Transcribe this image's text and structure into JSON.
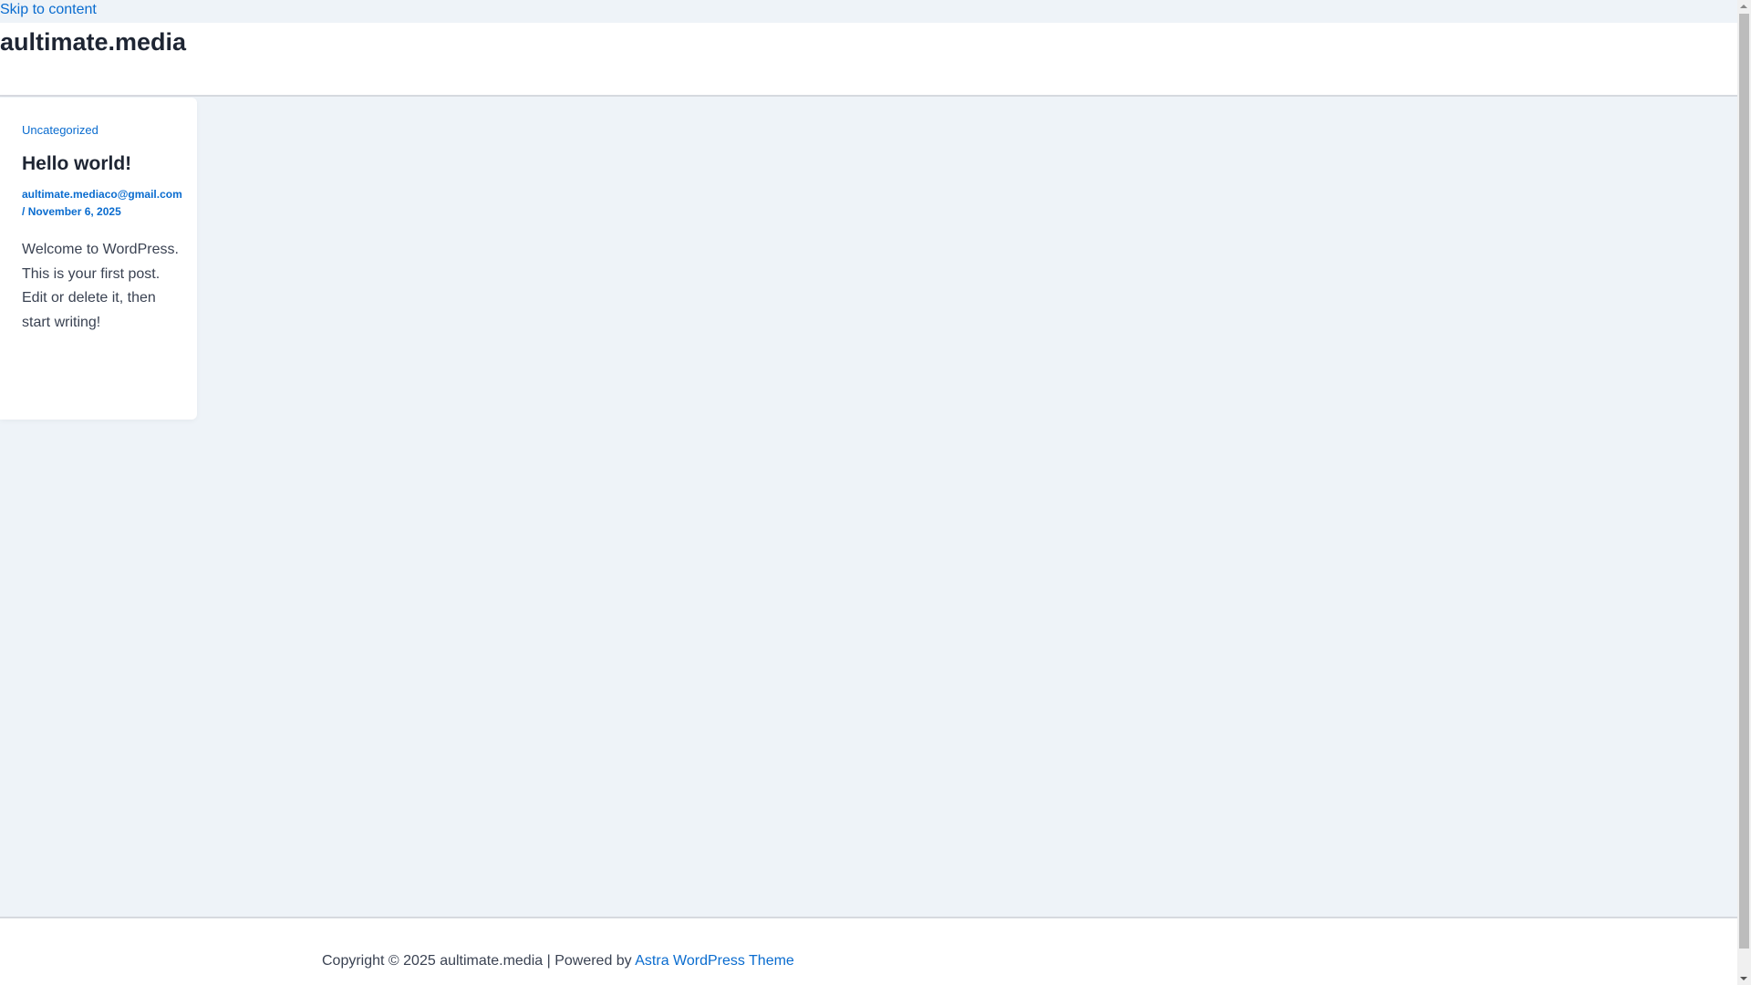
{
  "skip_link": "Skip to content",
  "header": {
    "site_title": "aultimate.media"
  },
  "post": {
    "category": "Uncategorized",
    "title": "Hello world!",
    "author": "aultimate.mediaco@gmail.com",
    "separator": "/",
    "date": "November 6, 2025",
    "excerpt": "Welcome to WordPress. This is your first post. Edit or delete it, then start writing!"
  },
  "footer": {
    "copyright": "Copyright © 2025 aultimate.media | Powered by ",
    "theme_link": "Astra WordPress Theme"
  }
}
